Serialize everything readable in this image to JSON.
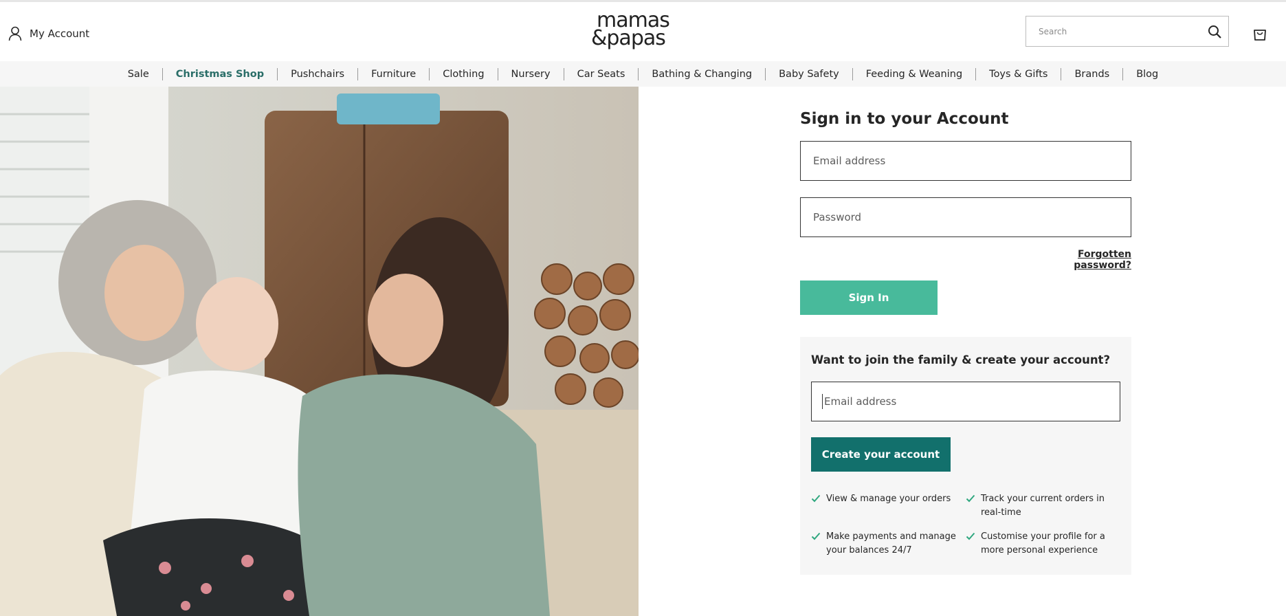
{
  "header": {
    "account_label": "My Account",
    "logo_line1": "mamas",
    "logo_line2": "&papas",
    "search_placeholder": "Search",
    "icons": {
      "account": "user-icon",
      "search": "search-icon",
      "bag": "shopping-bag-icon"
    }
  },
  "nav": {
    "items": [
      {
        "label": "Sale"
      },
      {
        "label": "Christmas Shop",
        "highlight": true
      },
      {
        "label": "Pushchairs"
      },
      {
        "label": "Furniture"
      },
      {
        "label": "Clothing"
      },
      {
        "label": "Nursery"
      },
      {
        "label": "Car Seats"
      },
      {
        "label": "Bathing & Changing"
      },
      {
        "label": "Baby Safety"
      },
      {
        "label": "Feeding & Weaning"
      },
      {
        "label": "Toys & Gifts"
      },
      {
        "label": "Brands"
      },
      {
        "label": "Blog"
      }
    ]
  },
  "signin": {
    "title": "Sign in to your Account",
    "email_placeholder": "Email address",
    "password_placeholder": "Password",
    "forgot_label": "Forgotten password?",
    "button_label": "Sign In"
  },
  "join": {
    "title": "Want to join the family & create your account?",
    "email_placeholder": "Email address",
    "button_label": "Create your account",
    "benefits": [
      "View & manage your orders",
      "Track your current orders in real-time",
      "Make payments and manage your balances 24/7",
      "Customise your profile for a more personal experience"
    ]
  },
  "colors": {
    "accent_green": "#48ba9b",
    "dark_teal": "#12706c",
    "nav_highlight": "#2a6e68",
    "tick": "#2fa77f"
  }
}
